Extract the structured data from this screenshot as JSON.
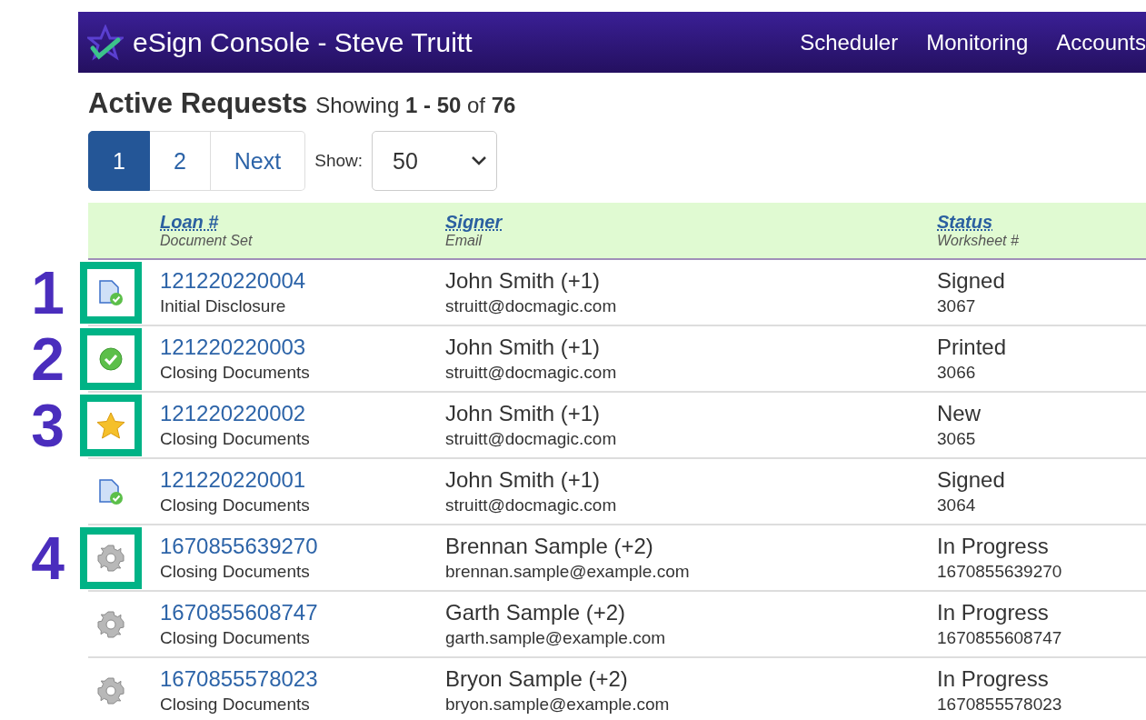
{
  "navbar": {
    "title": "eSign Console - Steve Truitt",
    "links": [
      "Scheduler",
      "Monitoring",
      "Accounts"
    ]
  },
  "heading": {
    "title": "Active Requests",
    "summary": "Showing **1 - 50** of **76**"
  },
  "pagination": {
    "pages": [
      {
        "label": "1",
        "selected": true
      },
      {
        "label": "2",
        "selected": false
      }
    ],
    "next": "Next",
    "show_label": "Show:",
    "show_value": "50"
  },
  "table": {
    "columns": [
      {
        "title": "Loan #",
        "subtitle": "Document Set"
      },
      {
        "title": "Signer",
        "subtitle": "Email"
      },
      {
        "title": "Status",
        "subtitle": "Worksheet #"
      }
    ],
    "rows": [
      {
        "kind": "document",
        "callout": "1",
        "highlighted": true,
        "loan": "121220220004",
        "document_set": "Initial Disclosure",
        "signer": "John Smith (+1)",
        "email": "struitt@docmagic.com",
        "status": "Signed",
        "worksheet": "3067"
      },
      {
        "kind": "check",
        "callout": "2",
        "highlighted": true,
        "loan": "121220220003",
        "document_set": "Closing Documents",
        "signer": "John Smith (+1)",
        "email": "struitt@docmagic.com",
        "status": "Printed",
        "worksheet": "3066"
      },
      {
        "kind": "star",
        "callout": "3",
        "highlighted": true,
        "loan": "121220220002",
        "document_set": "Closing Documents",
        "signer": "John Smith (+1)",
        "email": "struitt@docmagic.com",
        "status": "New",
        "worksheet": "3065"
      },
      {
        "kind": "document",
        "highlighted": false,
        "loan": "121220220001",
        "document_set": "Closing Documents",
        "signer": "John Smith (+1)",
        "email": "struitt@docmagic.com",
        "status": "Signed",
        "worksheet": "3064"
      },
      {
        "kind": "gear",
        "callout": "4",
        "highlighted": true,
        "loan": "1670855639270",
        "document_set": "Closing Documents",
        "signer": "Brennan Sample (+2)",
        "email": "brennan.sample@example.com",
        "status": "In Progress",
        "worksheet": "1670855639270"
      },
      {
        "kind": "gear",
        "highlighted": false,
        "loan": "1670855608747",
        "document_set": "Closing Documents",
        "signer": "Garth Sample (+2)",
        "email": "garth.sample@example.com",
        "status": "In Progress",
        "worksheet": "1670855608747"
      },
      {
        "kind": "gear",
        "highlighted": false,
        "loan": "1670855578023",
        "document_set": "Closing Documents",
        "signer": "Bryon Sample (+2)",
        "email": "bryon.sample@example.com",
        "status": "In Progress",
        "worksheet": "1670855578023"
      }
    ]
  }
}
